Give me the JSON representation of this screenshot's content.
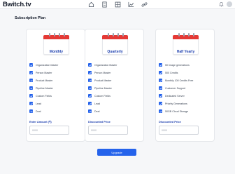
{
  "app": {
    "title": "Bwitch.tv"
  },
  "nav": {
    "icons": [
      "home-icon",
      "document-icon",
      "grid-icon",
      "chart-icon",
      "link-icon"
    ]
  },
  "page": {
    "title": "Subscription Plan"
  },
  "plans": [
    {
      "name": "Monthly",
      "features": [
        "Organization Master",
        "Person Master",
        "Product Master",
        "Pipeline Master",
        "Custom Fields",
        "Lead",
        "Deal"
      ],
      "price_label": "Enter Amount (₹)",
      "price_placeholder": "0000"
    },
    {
      "name": "Quarterly",
      "features": [
        "Organization Master",
        "Person Master",
        "Product Master",
        "Pipeline Master",
        "Custom Fields",
        "Lead",
        "Deal"
      ],
      "price_label": "Discounted Price",
      "price_placeholder": "0000"
    },
    {
      "name": "Half Yearly",
      "features": [
        "50 Image generations",
        "500 Credits",
        "Monthly 100 Credits Free",
        "Customer Support",
        "Dedicated Server",
        "Priority Generations",
        "50GB Cloud Storage"
      ],
      "price_label": "Discounted Price",
      "price_placeholder": "0000"
    }
  ],
  "actions": {
    "upgrade_label": "Upgrade"
  },
  "colors": {
    "accent": "#2563eb",
    "calendar_red": "#e53935",
    "plan_name": "#1e40af"
  }
}
